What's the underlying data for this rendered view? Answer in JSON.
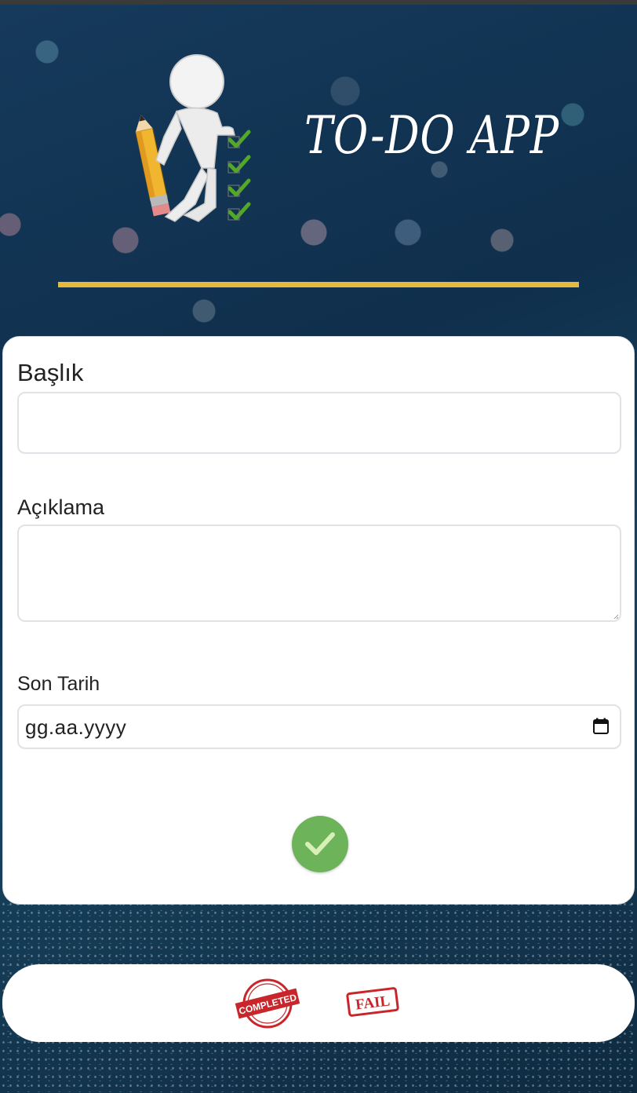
{
  "header": {
    "app_title": "TO-DO APP"
  },
  "form": {
    "title_label": "Başlık",
    "title_value": "",
    "description_label": "Açıklama",
    "description_value": "",
    "due_date_label": "Son Tarih",
    "due_date_placeholder": "gg.aa.yyyy"
  },
  "bottom_bar": {
    "completed_stamp_text": "COMPLETED",
    "fail_stamp_text": "FAIL"
  },
  "colors": {
    "accent_divider": "#e6b93a",
    "submit_green": "#6cb35a",
    "stamp_red": "#c8262a"
  },
  "icons": {
    "mascot": "mascot-with-pencil-checklist-icon",
    "calendar": "calendar-icon",
    "submit": "checkmark-icon"
  }
}
